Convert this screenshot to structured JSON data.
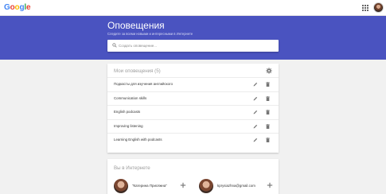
{
  "topbar": {
    "logo_letters": [
      {
        "char": "G",
        "color": "#4285f4"
      },
      {
        "char": "o",
        "color": "#ea4335"
      },
      {
        "char": "o",
        "color": "#fbbc05"
      },
      {
        "char": "g",
        "color": "#4285f4"
      },
      {
        "char": "l",
        "color": "#34a853"
      },
      {
        "char": "e",
        "color": "#ea4335"
      }
    ],
    "apps_icon": "apps-grid-icon",
    "avatar_icon": "user-avatar"
  },
  "hero": {
    "title": "Оповещения",
    "subtitle": "Следите за всеми новыми и интересными в Интернете",
    "background": "#4a53c0",
    "search_placeholder": "Создать оповещение..."
  },
  "alerts": {
    "title": "Мои оповещения (5)",
    "items": [
      {
        "label": "Подкасты для изучения английского"
      },
      {
        "label": "Communication skills"
      },
      {
        "label": "English podcasts"
      },
      {
        "label": "Improving listening"
      },
      {
        "label": "Learning English with podcasts"
      }
    ]
  },
  "internet": {
    "title": "Вы в Интернете",
    "people": [
      {
        "name": "\"Катерина Присяжна\""
      },
      {
        "name": "kprysiazhna@gmail.com"
      }
    ]
  }
}
